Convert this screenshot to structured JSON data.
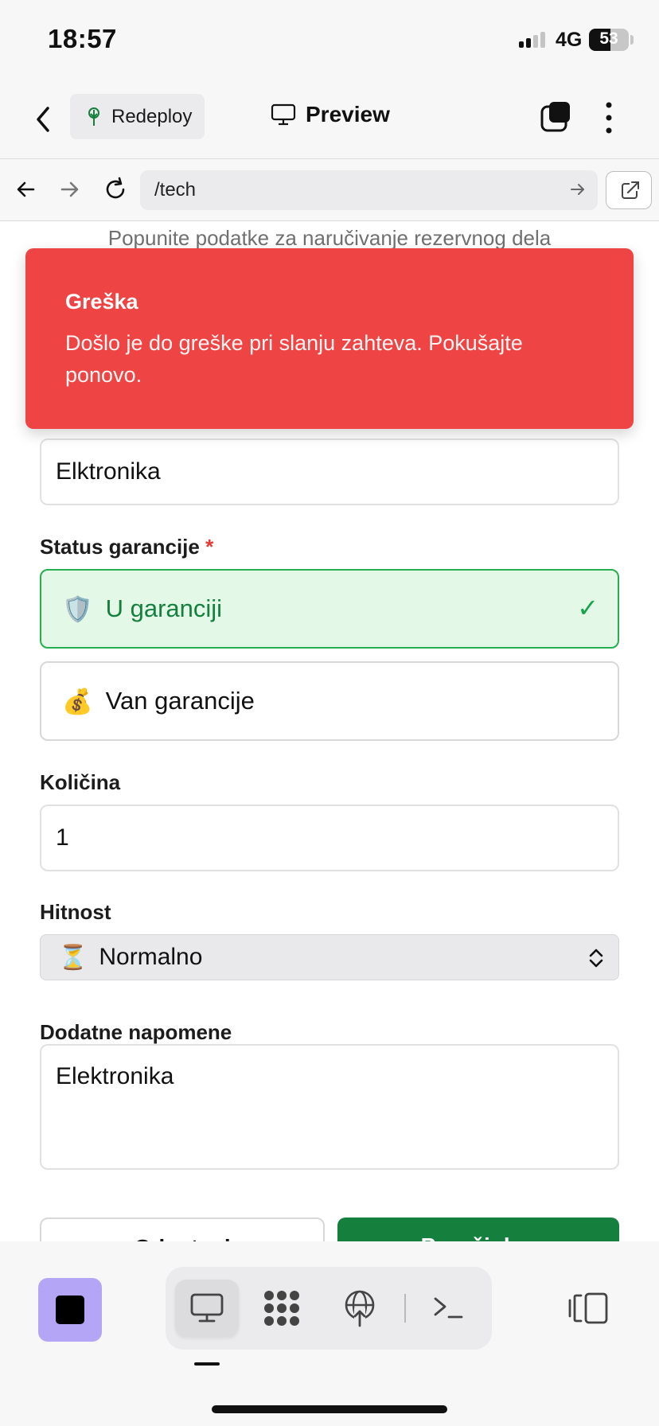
{
  "status_bar": {
    "time": "18:57",
    "network": "4G",
    "battery": "53"
  },
  "app_header": {
    "redeploy_label": "Redeploy",
    "preview_label": "Preview"
  },
  "url_bar": {
    "url": "/tech"
  },
  "form": {
    "subtitle": "Popunite podatke za naručivanje rezervnog dela",
    "category_value": "Elktronika",
    "warranty_label": "Status garancije",
    "required_mark": "*",
    "warranty_options": [
      {
        "emoji": "🛡️",
        "label": "U garanciji",
        "selected": true,
        "check": "✓"
      },
      {
        "emoji": "💰",
        "label": "Van garancije",
        "selected": false
      }
    ],
    "quantity_label": "Količina",
    "quantity_value": "1",
    "urgency_label": "Hitnost",
    "urgency_emoji": "⏳",
    "urgency_value": "Normalno",
    "notes_label": "Dodatne napomene",
    "notes_value": "Elektronika",
    "cancel_label": "Odustani",
    "submit_label": "Poruči deo"
  },
  "toast": {
    "title": "Greška",
    "message": "Došlo je do greške pri slanju zahteva. Pokušajte ponovo."
  },
  "bottom_toolbar": {
    "icons": [
      "stop-icon",
      "monitor-icon",
      "grid-icon",
      "globe-upload-icon",
      "terminal-icon",
      "panel-icon"
    ]
  },
  "colors": {
    "toast_bg": "#ef4444",
    "selected_option_bg": "#e3f8e7",
    "selected_option_border": "#27ae50",
    "submit_bg": "#15803d",
    "stop_button_bg": "#b4a5f7"
  }
}
